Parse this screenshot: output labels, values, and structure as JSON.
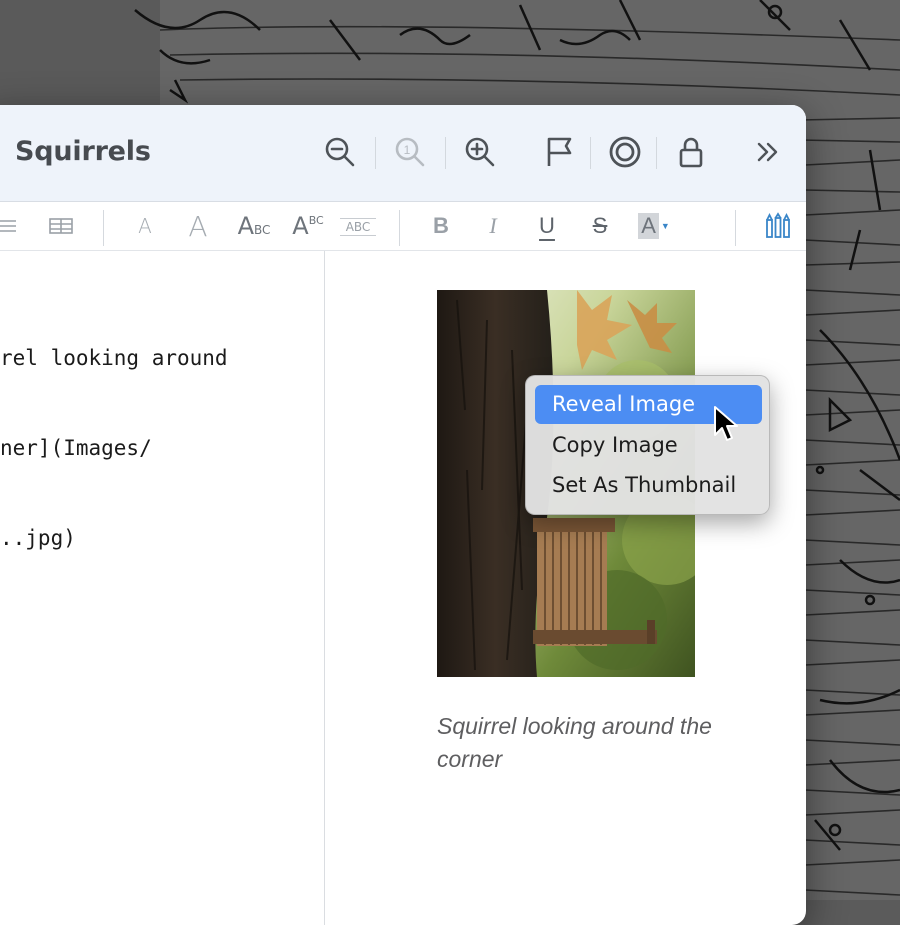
{
  "window": {
    "title": "Squirrels"
  },
  "toolbar": {
    "buttons": [
      {
        "name": "zoom-out-icon"
      },
      {
        "name": "actual-size-icon",
        "badge": "1"
      },
      {
        "name": "zoom-in-icon"
      },
      {
        "name": "flag-icon"
      },
      {
        "name": "target-icon"
      },
      {
        "name": "lock-icon"
      },
      {
        "name": "more-chevrons-icon"
      }
    ]
  },
  "format_bar": {
    "style_buttons": [
      {
        "name": "small-a",
        "label": "A"
      },
      {
        "name": "large-a",
        "label": "A"
      },
      {
        "name": "small-caps",
        "label": "A",
        "sub": "BC"
      },
      {
        "name": "superscript",
        "label": "A",
        "sup": "BC"
      },
      {
        "name": "all-caps",
        "label": "ABC"
      }
    ],
    "text_buttons": [
      {
        "name": "bold",
        "label": "B"
      },
      {
        "name": "italic",
        "label": "I"
      },
      {
        "name": "underline",
        "label": "U"
      },
      {
        "name": "strikethrough",
        "label": "S"
      },
      {
        "name": "highlight",
        "label": "A"
      }
    ]
  },
  "editor": {
    "lines": [
      "rel looking around",
      "ner](Images/",
      "..jpg)"
    ]
  },
  "preview": {
    "caption": "Squirrel looking around the corner"
  },
  "context_menu": {
    "items": [
      {
        "label": "Reveal Image",
        "highlighted": true
      },
      {
        "label": "Copy Image",
        "highlighted": false
      },
      {
        "label": "Set As Thumbnail",
        "highlighted": false
      }
    ]
  },
  "colors": {
    "highlight": "#4c8df3",
    "titlebar": "#eef3fa",
    "accent_icon": "#3a86c8"
  }
}
